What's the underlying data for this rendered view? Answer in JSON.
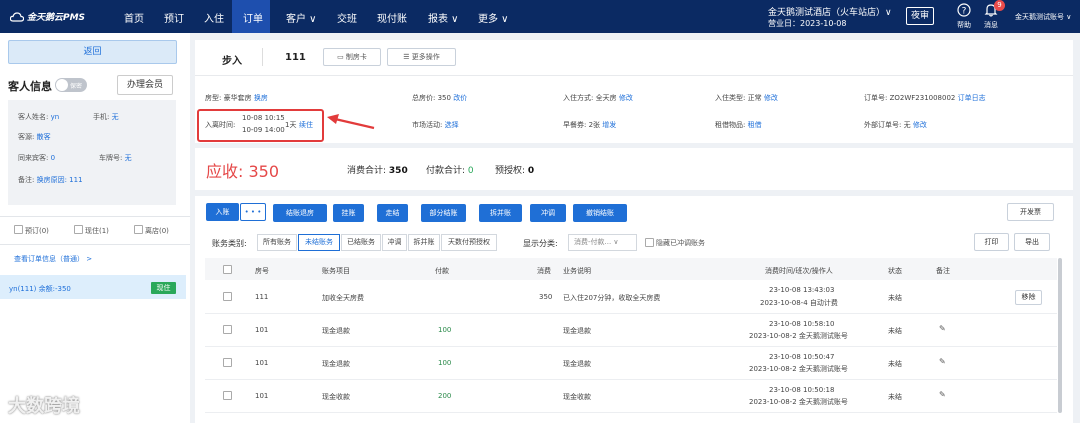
{
  "app": {
    "logo": "金天鹅云PMS"
  },
  "nav": {
    "items": [
      "首页",
      "预订",
      "入住",
      "订单",
      "客户 ∨",
      "交班",
      "现付账",
      "报表 ∨",
      "更多 ∨"
    ],
    "active": "订单"
  },
  "header": {
    "hotel": "金天鹅测试酒店（火车站店）∨",
    "biz_date": "营业日：2023-10-08",
    "night_audit": "夜审",
    "help": "帮助",
    "messages": "消息",
    "message_count": "9",
    "user": "金天鹅测试账号 ∨"
  },
  "left": {
    "back": "返回",
    "guest_title": "客人信息",
    "privacy_toggle": "保密",
    "member_btn": "办理会员",
    "guest": {
      "name_label": "客人姓名:",
      "name": "yn",
      "phone_label": "手机:",
      "phone": "无",
      "source_label": "客源:",
      "source": "散客",
      "companions_label": "同来宾客:",
      "companions": "0",
      "plate_label": "车牌号:",
      "plate": "无",
      "remark_label": "备注:",
      "remark": "换房原因: 111"
    },
    "checks": [
      "预订(0)",
      "现住(1)",
      "离店(0)"
    ],
    "order_link": "查看订单信息（普通） >",
    "order_card": {
      "text": "yn(111)  余额:-350",
      "tag": "现住"
    },
    "watermark": "大数跨境"
  },
  "order": {
    "type": "步入",
    "room": "111",
    "make_card": "制房卡",
    "more_ops": "更多操作",
    "room_type_label": "房型: 豪华套房",
    "room_type_link": "换房",
    "total_label": "总房价: 350",
    "total_link": "改价",
    "checkin_method_label": "入住方式: 全天房",
    "checkin_method_link": "修改",
    "checkin_type_label": "入住类型: 正常",
    "checkin_type_link": "修改",
    "order_no_label": "订单号: ZO2WF231008002",
    "order_no_link": "订单日志",
    "stay_label": "入离时间:",
    "stay_in": "10-08 10:15",
    "stay_out": "10-09 14:00",
    "stay_days": "1天",
    "stay_link": "续住",
    "market_label": "市场活动:",
    "market_link": "选择",
    "breakfast_label": "早餐券: 2张",
    "breakfast_link": "增发",
    "rental_label": "租借物品:",
    "rental_link": "租借",
    "ext_order_label": "外部订单号: 无",
    "ext_order_link": "修改"
  },
  "summary": {
    "receivable": "应收: 350",
    "consume_label": "消费合计:",
    "consume": "350",
    "payment_label": "付款合计:",
    "payment": "0",
    "preauth_label": "预授权:",
    "preauth": "0"
  },
  "actions": {
    "buttons": [
      "入账",
      "• • •",
      "结账退房",
      "挂账",
      "走结",
      "部分结账",
      "拆并账",
      "冲调",
      "撤销结账"
    ],
    "invoice": "开发票",
    "filter_label": "账务类别:",
    "filters": [
      "所有账务",
      "未结账务",
      "已结账务",
      "冲调",
      "拆并账",
      "天数付预授权"
    ],
    "active_filter": "未结账务",
    "category_label": "显示分类:",
    "category_select": "消费-付款...  ∨",
    "hide_reversed": "隐藏已冲调账务",
    "print": "打印",
    "export": "导出"
  },
  "table": {
    "headers": [
      "房号",
      "账务项目",
      "付款",
      "消费",
      "业务说明",
      "消费时间/班次/操作人",
      "状态",
      "备注"
    ],
    "rows": [
      {
        "room": "111",
        "item": "加收全天房费",
        "pay": "",
        "consume": "350",
        "desc": "已入住207分钟，收取全天房费",
        "time1": "23-10-08 13:43:03",
        "time2": "2023-10-08-4 自动计费",
        "status": "未结",
        "action": "移除"
      },
      {
        "room": "101",
        "item": "现金退款",
        "pay": "100",
        "consume": "",
        "desc": "现金退款",
        "time1": "23-10-08 10:58:10",
        "time2": "2023-10-08-2 金天鹅测试账号",
        "status": "未结",
        "action": "✎"
      },
      {
        "room": "101",
        "item": "现金退款",
        "pay": "100",
        "consume": "",
        "desc": "现金退款",
        "time1": "23-10-08 10:50:47",
        "time2": "2023-10-08-2 金天鹅测试账号",
        "status": "未结",
        "action": "✎"
      },
      {
        "room": "101",
        "item": "现金收款",
        "pay": "200",
        "consume": "",
        "desc": "现金收款",
        "time1": "23-10-08 10:50:18",
        "time2": "2023-10-08-2 金天鹅测试账号",
        "status": "未结",
        "action": "✎"
      }
    ]
  }
}
